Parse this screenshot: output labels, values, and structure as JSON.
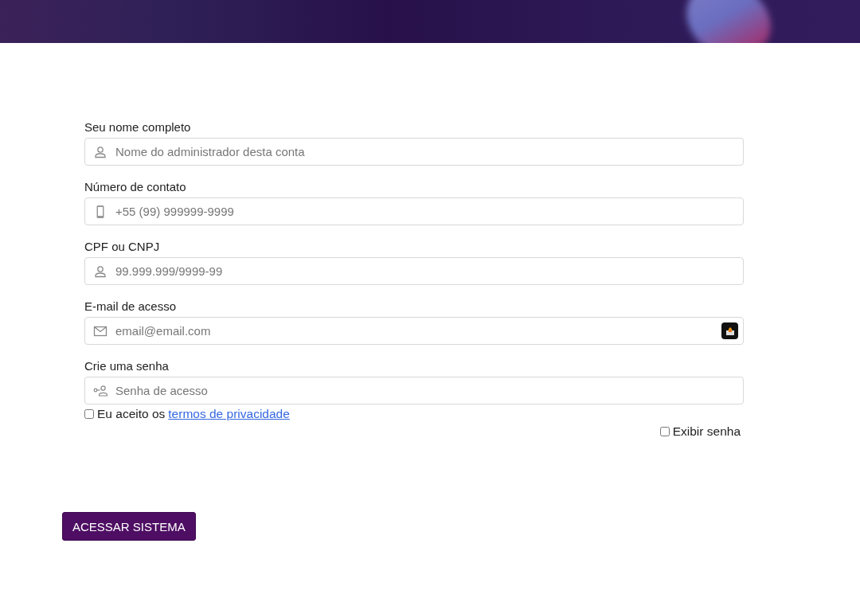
{
  "fields": [
    {
      "label": "Seu nome completo",
      "placeholder": "Nome do administrador desta conta",
      "autofill_badge": false
    },
    {
      "label": "Número de contato",
      "placeholder": "+55 (99) 999999-9999",
      "autofill_badge": false
    },
    {
      "label": "CPF ou CNPJ",
      "placeholder": "99.999.999/9999-99",
      "autofill_badge": false
    },
    {
      "label": "E-mail de acesso",
      "placeholder": "email@email.com",
      "autofill_badge": true
    },
    {
      "label": "Crie uma senha",
      "placeholder": "Senha de acesso",
      "autofill_badge": false
    }
  ],
  "terms": {
    "checked": false,
    "text": "Eu aceito os",
    "link": "termos de privacidade"
  },
  "show_password": {
    "checked": false,
    "label": "Exibir senha"
  },
  "submit_button": "ACESSAR SISTEMA"
}
